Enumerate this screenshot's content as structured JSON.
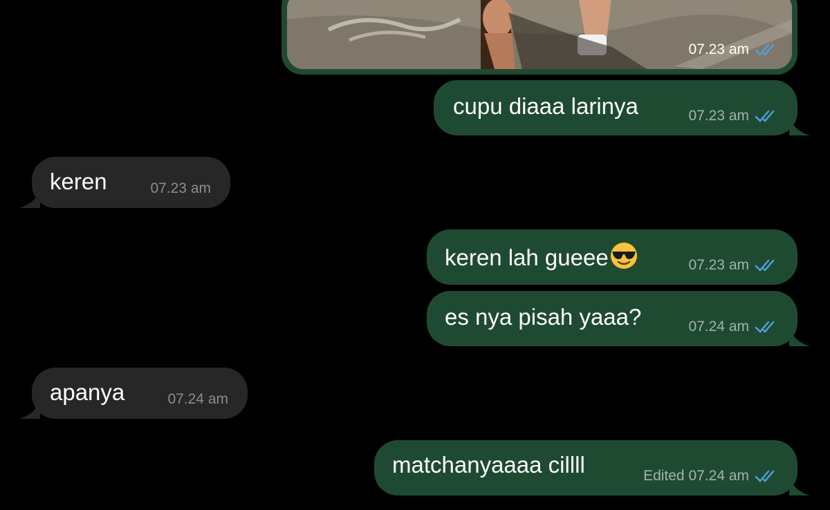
{
  "colors": {
    "background": "#000000",
    "outgoing_bubble": "#1f4a32",
    "incoming_bubble": "#272727",
    "read_ticks": "#4fa3e0"
  },
  "messages": [
    {
      "direction": "outgoing",
      "type": "image",
      "time": "07.23 am",
      "status": "read-double-tick"
    },
    {
      "direction": "outgoing",
      "text": "cupu diaaa larinya",
      "time": "07.23 am",
      "status": "read-double-tick"
    },
    {
      "direction": "incoming",
      "text": "keren",
      "time": "07.23 am"
    },
    {
      "direction": "outgoing",
      "text": "keren lah gueee",
      "emoji": "smiling-face-with-sunglasses",
      "time": "07.23 am",
      "status": "read-double-tick"
    },
    {
      "direction": "outgoing",
      "text": "es nya pisah yaaa?",
      "time": "07.24 am",
      "status": "read-double-tick"
    },
    {
      "direction": "incoming",
      "text": "apanya",
      "time": "07.24 am"
    },
    {
      "direction": "outgoing",
      "text": "matchanyaaaa cillll",
      "time": "Edited 07.24 am",
      "status": "read-double-tick"
    }
  ]
}
